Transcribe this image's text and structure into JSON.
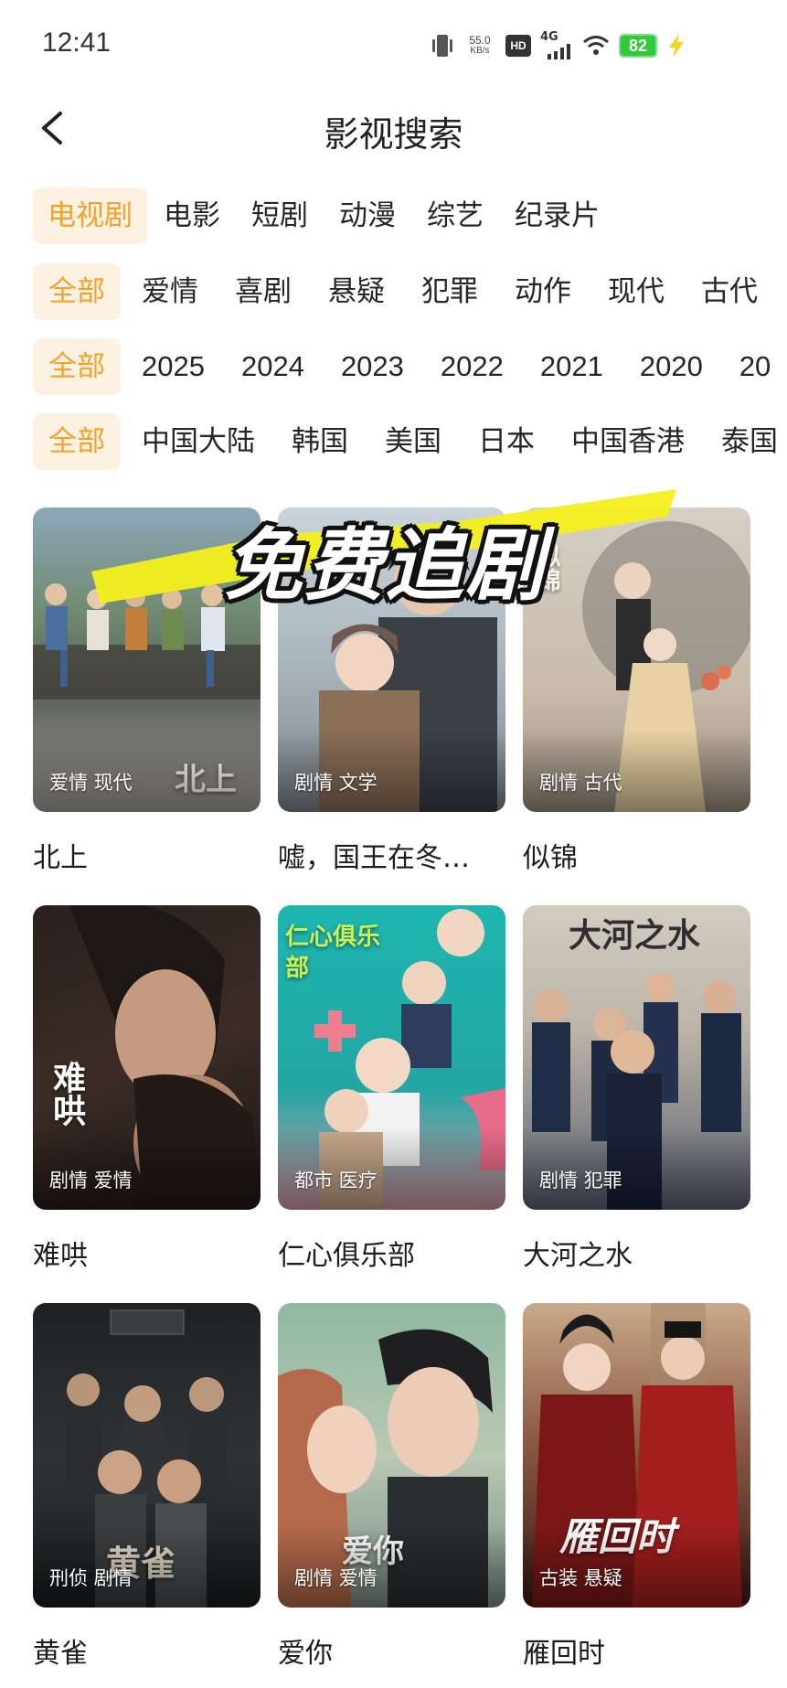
{
  "status": {
    "time": "12:41",
    "net_speed_value": "55.0",
    "net_speed_unit": "KB/s",
    "hd": "HD",
    "network": "4G",
    "battery": "82"
  },
  "header": {
    "title": "影视搜索"
  },
  "filters": {
    "type": [
      "电视剧",
      "电影",
      "短剧",
      "动漫",
      "综艺",
      "纪录片"
    ],
    "genre": [
      "全部",
      "爱情",
      "喜剧",
      "悬疑",
      "犯罪",
      "动作",
      "现代",
      "古代"
    ],
    "year": [
      "全部",
      "2025",
      "2024",
      "2023",
      "2022",
      "2021",
      "2020",
      "20"
    ],
    "region": [
      "全部",
      "中国大陆",
      "韩国",
      "美国",
      "日本",
      "中国香港",
      "泰国"
    ]
  },
  "overlay": {
    "banner": "免费追剧"
  },
  "items": [
    {
      "title": "北上",
      "tags": "爱情 现代",
      "poster_text": "北上"
    },
    {
      "title": "嘘，国王在冬…",
      "tags": "剧情 文学",
      "poster_text": ""
    },
    {
      "title": "似锦",
      "tags": "剧情 古代",
      "poster_text": "似锦"
    },
    {
      "title": "难哄",
      "tags": "剧情 爱情",
      "poster_text": "难哄"
    },
    {
      "title": "仁心俱乐部",
      "tags": "都市 医疗",
      "poster_text": "仁心俱乐部"
    },
    {
      "title": "大河之水",
      "tags": "剧情 犯罪",
      "poster_text": "大河之水"
    },
    {
      "title": "黄雀",
      "tags": "刑侦 剧情",
      "poster_text": "黄雀"
    },
    {
      "title": "爱你",
      "tags": "剧情 爱情",
      "poster_text": "爱你"
    },
    {
      "title": "雁回时",
      "tags": "古装 悬疑",
      "poster_text": "雁回时"
    }
  ],
  "colors": {
    "accent": "#f5a22d",
    "chip_active_bg": "#fdf1e2",
    "highlight_stroke": "#f4ef1c"
  }
}
